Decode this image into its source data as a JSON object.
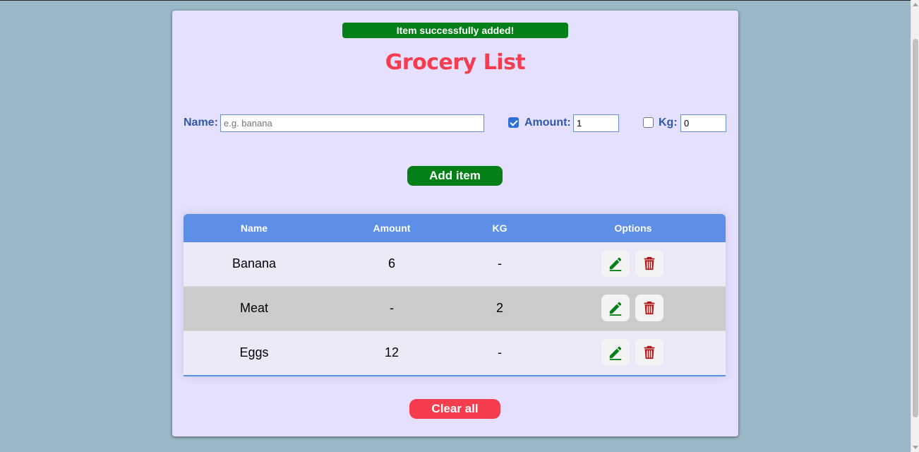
{
  "alert": {
    "message": "Item successfully added!",
    "color": "#058018"
  },
  "title": "Grocery List",
  "form": {
    "name_label": "Name:",
    "name_placeholder": "e.g. banana",
    "name_value": "",
    "amount_label": "Amount:",
    "amount_checked": true,
    "amount_value": "1",
    "kg_label": "Kg:",
    "kg_checked": false,
    "kg_value": "0",
    "add_label": "Add item"
  },
  "table": {
    "headers": [
      "Name",
      "Amount",
      "KG",
      "Options"
    ],
    "rows": [
      {
        "name": "Banana",
        "amount": "6",
        "kg": "-"
      },
      {
        "name": "Meat",
        "amount": "-",
        "kg": "2"
      },
      {
        "name": "Eggs",
        "amount": "12",
        "kg": "-"
      }
    ],
    "icons": {
      "edit": "pencil-icon",
      "delete": "trash-icon"
    }
  },
  "clear_label": "Clear all",
  "colors": {
    "accent_green": "#058018",
    "accent_red": "#f53d4f",
    "header_blue": "#5d8fe6",
    "label_blue": "#2f5aa8",
    "card_bg": "#e6e0ff",
    "page_bg": "#9ab8c8",
    "delete_icon": "#b01818"
  }
}
